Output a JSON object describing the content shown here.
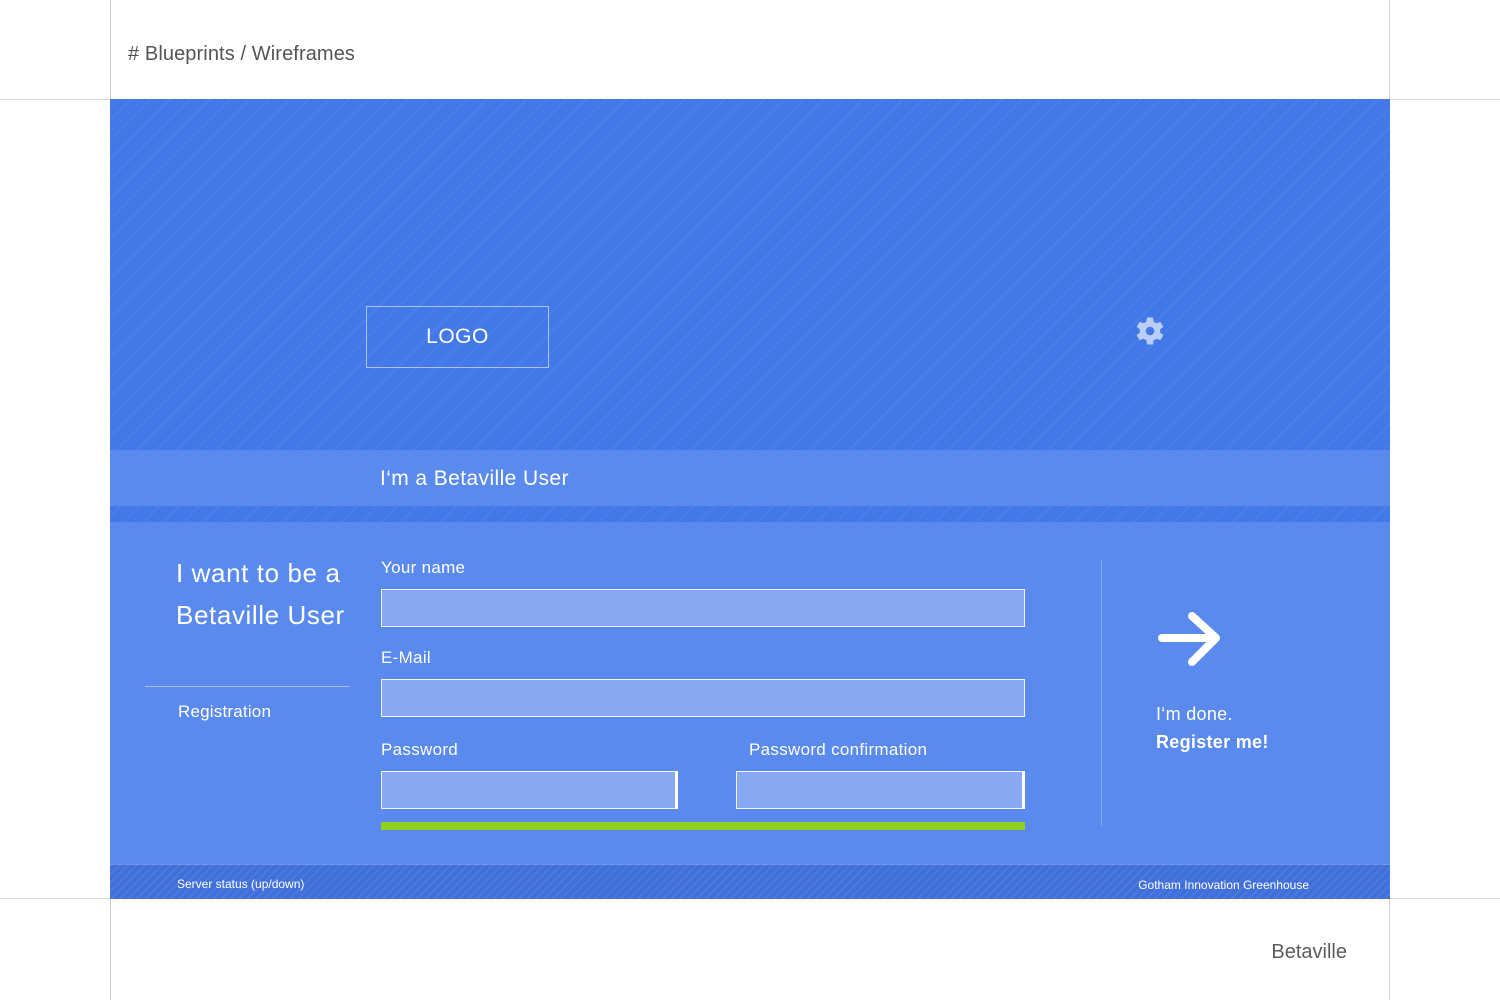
{
  "breadcrumb": "# Blueprints / Wireframes",
  "brand_footer": "Betaville",
  "hero": {
    "logo_label": "LOGO",
    "settings_icon": "gear-icon"
  },
  "user_bar": {
    "label": "I‘m a Betaville User"
  },
  "intro": {
    "title": "I want to be a Betaville User",
    "subtitle": "Registration"
  },
  "form": {
    "name_label": "Your name",
    "name_value": "",
    "email_label": "E-Mail",
    "email_value": "",
    "password_label": "Password",
    "password_value": "",
    "password_confirm_label": "Password confirmation",
    "password_confirm_value": "",
    "strength_color": "#8fd120"
  },
  "cta": {
    "icon": "arrow-right-icon",
    "line1": "I‘m done.",
    "line2": "Register me!"
  },
  "footer": {
    "server_status": "Server status (up/down)",
    "credit": "Gotham Innovation Greenhouse"
  },
  "colors": {
    "primary_blue": "#4378e8",
    "panel_blue": "#5a8aee",
    "input_fill": "#88a8f2",
    "footer_blue": "#3f6fda"
  }
}
